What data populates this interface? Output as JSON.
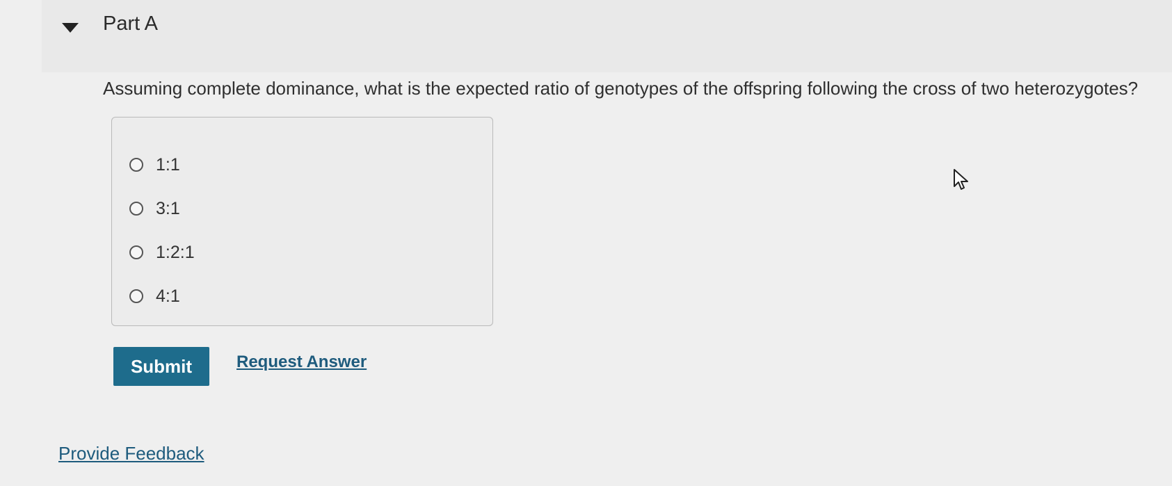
{
  "part": {
    "title": "Part A"
  },
  "question": {
    "text": "Assuming complete dominance, what is the expected ratio of genotypes of the offspring following the cross of two heterozygotes?",
    "options": [
      {
        "label": "1:1"
      },
      {
        "label": "3:1"
      },
      {
        "label": "1:2:1"
      },
      {
        "label": "4:1"
      }
    ]
  },
  "actions": {
    "submit_label": "Submit",
    "request_answer_label": "Request Answer"
  },
  "footer": {
    "feedback_label": "Provide Feedback"
  },
  "colors": {
    "submit_bg": "#1e6c8c",
    "link": "#1e5b7d",
    "background": "#efefef"
  },
  "icons": {
    "toggle": "caret-down-icon",
    "pointer": "mouse-pointer-icon"
  }
}
